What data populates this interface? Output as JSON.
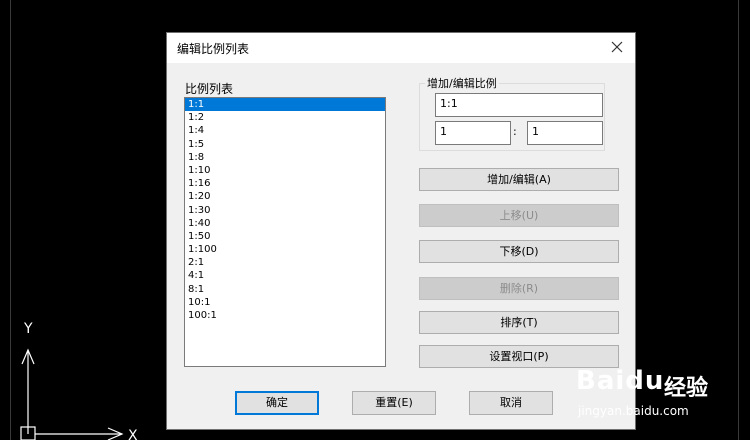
{
  "cad": {
    "axis_y_label": "Y",
    "axis_x_label": "X"
  },
  "dialog": {
    "title": "编辑比例列表",
    "list_label": "比例列表",
    "scales": [
      "1:1",
      "1:2",
      "1:4",
      "1:5",
      "1:8",
      "1:10",
      "1:16",
      "1:20",
      "1:30",
      "1:40",
      "1:50",
      "1:100",
      "2:1",
      "4:1",
      "8:1",
      "10:1",
      "100:1"
    ],
    "selected_scale": "1:1",
    "group_label": "增加/编辑比例",
    "name_value": "1:1",
    "paper_units": "1",
    "drawing_units": "1",
    "colon": ":",
    "buttons": {
      "add_edit": "增加/编辑(A)",
      "move_up": "上移(U)",
      "move_down": "下移(D)",
      "delete": "删除(R)",
      "sort": "排序(T)",
      "viewport": "设置视口(P)"
    },
    "footer": {
      "ok": "确定",
      "reset": "重置(E)",
      "cancel": "取消"
    }
  },
  "watermark": {
    "logo": "Baidu",
    "jingyan": "经验",
    "url": "jingyan.baidu.com"
  },
  "colors": {
    "selection": "#0078d7",
    "background": "#000000",
    "dialog": "#f0f0f0"
  }
}
